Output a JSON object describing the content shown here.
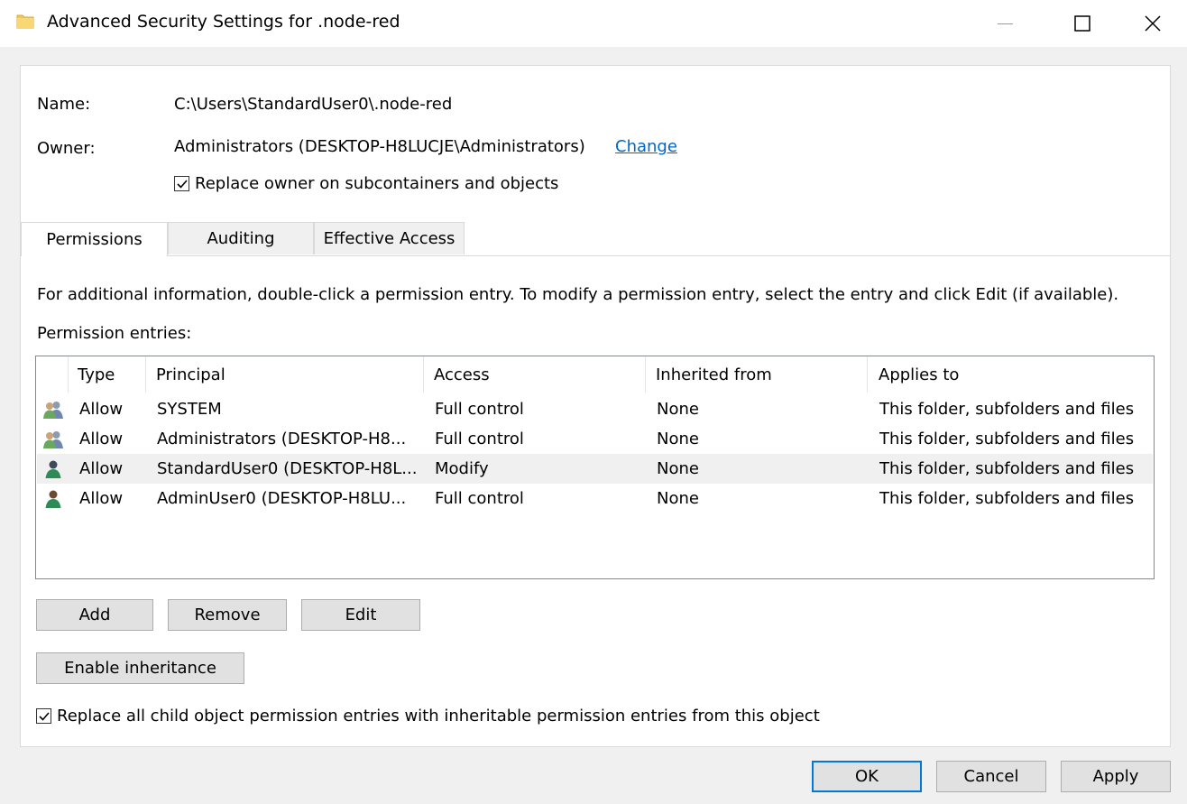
{
  "window": {
    "title": "Advanced Security Settings for .node-red",
    "minimize_glyph": "—",
    "maximize_glyph": "☐",
    "close_glyph": "✕"
  },
  "info": {
    "name_label": "Name:",
    "name_value": "C:\\Users\\StandardUser0\\.node-red",
    "owner_label": "Owner:",
    "owner_value": "Administrators (DESKTOP-H8LUCJE\\Administrators)",
    "change_link": "Change",
    "replace_owner_label": "Replace owner on subcontainers and objects",
    "replace_owner_checked": true
  },
  "tabs": [
    {
      "label": "Permissions",
      "active": true
    },
    {
      "label": "Auditing",
      "active": false
    },
    {
      "label": "Effective Access",
      "active": false
    }
  ],
  "permissions": {
    "info_text": "For additional information, double-click a permission entry. To modify a permission entry, select the entry and click Edit (if available).",
    "entries_label": "Permission entries:",
    "columns": [
      "Type",
      "Principal",
      "Access",
      "Inherited from",
      "Applies to"
    ],
    "rows": [
      {
        "icon": "group-icon",
        "type": "Allow",
        "principal": "SYSTEM",
        "access": "Full control",
        "inherited": "None",
        "applies": "This folder, subfolders and files",
        "selected": false
      },
      {
        "icon": "group-icon",
        "type": "Allow",
        "principal": "Administrators (DESKTOP-H8...",
        "access": "Full control",
        "inherited": "None",
        "applies": "This folder, subfolders and files",
        "selected": false
      },
      {
        "icon": "user-icon",
        "type": "Allow",
        "principal": "StandardUser0 (DESKTOP-H8L...",
        "access": "Modify",
        "inherited": "None",
        "applies": "This folder, subfolders and files",
        "selected": true
      },
      {
        "icon": "user-icon",
        "type": "Allow",
        "principal": "AdminUser0 (DESKTOP-H8LU...",
        "access": "Full control",
        "inherited": "None",
        "applies": "This folder, subfolders and files",
        "selected": false
      }
    ]
  },
  "buttons": {
    "add": "Add",
    "remove": "Remove",
    "edit": "Edit",
    "enable_inheritance": "Enable inheritance"
  },
  "replace_child": {
    "label": "Replace all child object permission entries with inheritable permission entries from this object",
    "checked": true
  },
  "footer": {
    "ok": "OK",
    "cancel": "Cancel",
    "apply": "Apply"
  },
  "colors": {
    "accent": "#0078d7",
    "link": "#0066cc"
  }
}
